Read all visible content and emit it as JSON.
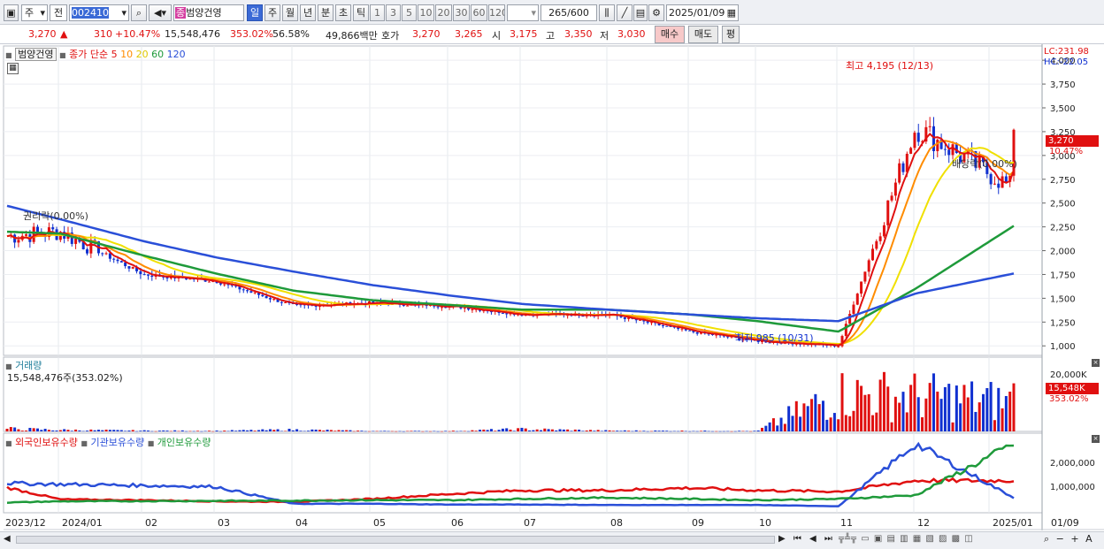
{
  "toolbar": {
    "type_select": "주",
    "market_select": "전",
    "code": "002410",
    "name": "범양건영",
    "periods": [
      "일",
      "주",
      "월",
      "년",
      "분",
      "초",
      "틱"
    ],
    "active_period": "일",
    "intervals": [
      "1",
      "3",
      "5",
      "10",
      "20",
      "30",
      "60",
      "120"
    ],
    "count": "265",
    "count_total": "/600",
    "date": "2025/01/09",
    "jong_badge": "종"
  },
  "quote": {
    "price": "3,270",
    "change": "310",
    "change_pct": "+10.47%",
    "volume": "15,548,476",
    "volume_pct": "353.02%",
    "turnover_pct": "56.58%",
    "amount": "49,866백만",
    "bid_label": "호가",
    "bid": "3,270",
    "ask": "3,265",
    "open_label": "시",
    "open": "3,175",
    "high_label": "고",
    "high": "3,350",
    "low_label": "저",
    "low": "3,030",
    "buy_label": "매수",
    "sell_label": "매도",
    "avg_label": "평"
  },
  "price_pane": {
    "stock_label": "범양건영",
    "close_label": "종가",
    "ma_label": "단순",
    "ma_periods": [
      "5",
      "10",
      "20",
      "60",
      "120"
    ],
    "lc": "LC:231.98",
    "hc": "HC:-22.05",
    "y_ticks": [
      "4,000",
      "3,750",
      "3,500",
      "3,250",
      "3,000",
      "2,750",
      "2,500",
      "2,250",
      "2,000",
      "1,750",
      "1,500",
      "1,250",
      "1,000"
    ],
    "current_price_tag": "3,270",
    "current_pct_tag": "10.47%",
    "high_annotation": "최고 4,195 (12/13)",
    "low_annotation": "최저 985 (10/31)",
    "rights1": "권리락(0.00%)",
    "rights2": "배당락(0.00%)"
  },
  "volume_pane": {
    "title": "거래량",
    "value": "15,548,476주(353.02%)",
    "y_tick": "20,000K",
    "tag_value": "15,548K",
    "tag_pct": "353.02%"
  },
  "holding_pane": {
    "legend": [
      "외국인보유수량",
      "기관보유수량",
      "개인보유수량"
    ],
    "y_ticks": [
      "2,000,000",
      "1,000,000"
    ]
  },
  "x_axis": {
    "labels": [
      "2023/12",
      "2024/01",
      "02",
      "03",
      "04",
      "05",
      "06",
      "07",
      "08",
      "09",
      "10",
      "11",
      "12",
      "2025/01"
    ],
    "right_label": "01/09"
  },
  "colors": {
    "up": "#e01010",
    "down": "#1030d0",
    "ma5": "#e01010",
    "ma10": "#ff8c00",
    "ma20": "#f0e000",
    "ma60": "#1e9a3a",
    "ma120": "#2a4fd8",
    "foreign": "#e01010",
    "inst": "#2a4fd8",
    "individual": "#1e9a3a"
  },
  "chart_data": [
    {
      "type": "line",
      "title": "",
      "x": [
        "2023/12",
        "2024/01",
        "02",
        "03",
        "04",
        "05",
        "06",
        "07",
        "08",
        "09",
        "10",
        "11",
        "12",
        "2025/01"
      ],
      "ylim": [
        900,
        4150
      ],
      "series": [
        {
          "name": "종가",
          "values": [
            2150,
            2200,
            1750,
            1680,
            1420,
            1450,
            1420,
            1330,
            1330,
            1150,
            1050,
            1000,
            3300,
            2650
          ]
        },
        {
          "name": "120",
          "values": [
            2480,
            2330,
            2100,
            1930,
            1780,
            1640,
            1530,
            1440,
            1380,
            1330,
            1290,
            1260,
            1550,
            1760
          ]
        },
        {
          "name": "60",
          "values": [
            2200,
            2180,
            1950,
            1760,
            1580,
            1480,
            1430,
            1380,
            1380,
            1330,
            1260,
            1150,
            1600,
            2260
          ]
        }
      ]
    },
    {
      "type": "bar",
      "title": "거래량",
      "categories": [
        "2023/12",
        "2024/01",
        "02",
        "03",
        "04",
        "05",
        "06",
        "07",
        "08",
        "09",
        "10",
        "11",
        "12",
        "2025/01"
      ],
      "values": [
        1500,
        800,
        400,
        300,
        900,
        200,
        200,
        1200,
        400,
        300,
        200,
        20000,
        19000,
        15548
      ],
      "ylim": [
        0,
        24000
      ]
    },
    {
      "type": "line",
      "title": "",
      "x": [
        "2023/12",
        "2024/01",
        "02",
        "03",
        "04",
        "05",
        "06",
        "07",
        "08",
        "09",
        "10",
        "11",
        "12",
        "2025/01"
      ],
      "ylim": [
        0,
        2900000
      ],
      "series": [
        {
          "name": "외국인보유수량",
          "values": [
            850000,
            330000,
            300000,
            250000,
            230000,
            350000,
            550000,
            700000,
            700000,
            800000,
            700000,
            650000,
            1100000,
            1100000
          ]
        },
        {
          "name": "기관보유수량",
          "values": [
            1000000,
            950000,
            900000,
            850000,
            150000,
            150000,
            120000,
            120000,
            100000,
            100000,
            100000,
            50000,
            2600000,
            400000
          ]
        },
        {
          "name": "개인보유수량",
          "values": [
            200000,
            250000,
            260000,
            270000,
            280000,
            300000,
            300000,
            350000,
            400000,
            350000,
            300000,
            350000,
            500000,
            2600000
          ]
        }
      ]
    }
  ]
}
